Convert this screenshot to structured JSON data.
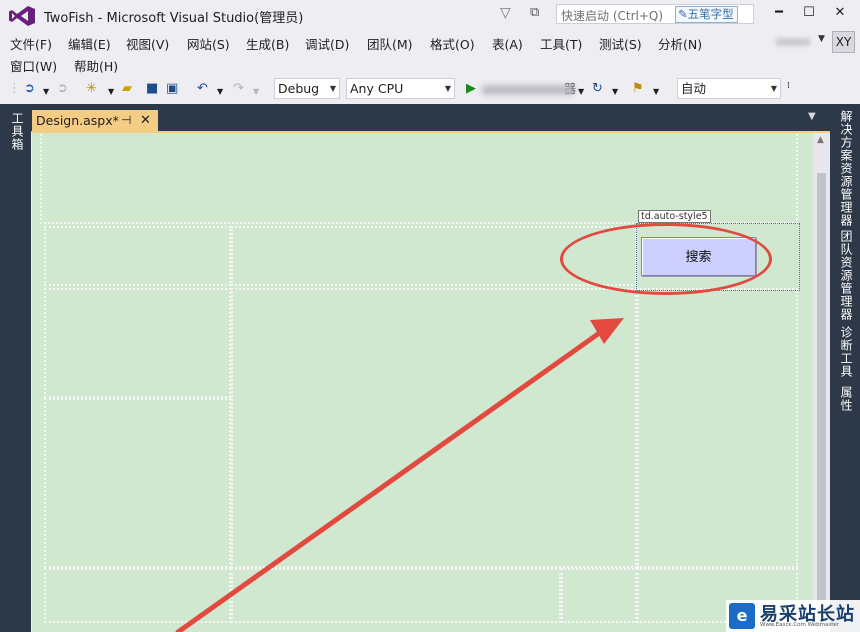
{
  "window": {
    "title": "TwoFish - Microsoft Visual Studio(管理员)",
    "quick_launch_placeholder": "快速启动 (Ctrl+Q)",
    "ime_badge": "五笔字型",
    "minimize": "━",
    "maximize": "☐",
    "close": "✕"
  },
  "menu": {
    "row1": [
      "文件(F)",
      "编辑(E)",
      "视图(V)",
      "网站(S)",
      "生成(B)",
      "调试(D)",
      "团队(M)",
      "格式(O)",
      "表(A)",
      "工具(T)",
      "测试(S)",
      "分析(N)"
    ],
    "row2": [
      "窗口(W)",
      "帮助(H)"
    ],
    "user_initials": "XY"
  },
  "toolbar": {
    "configuration": "Debug",
    "platform": "Any CPU",
    "run_target_suffix": "器",
    "auto_combo": "自动"
  },
  "side_panels": {
    "left": [
      "工具箱"
    ],
    "right": [
      "解决方案资源管理器",
      "团队资源管理器",
      "诊断工具",
      "属性"
    ]
  },
  "document": {
    "tab_label": "Design.aspx*",
    "pin": "⊣",
    "close": "✕",
    "cell_tag": "td.auto-style5",
    "search_button": "搜索"
  },
  "watermark": {
    "text": "易采站长站",
    "sub": "Www.Easck.Com  Webmaster"
  },
  "colors": {
    "accent_tab": "#f5cc84",
    "frame": "#2d3849",
    "design_surface": "#d0e7d0",
    "button": "#cdd0ff",
    "annotation": "#e2493f"
  }
}
